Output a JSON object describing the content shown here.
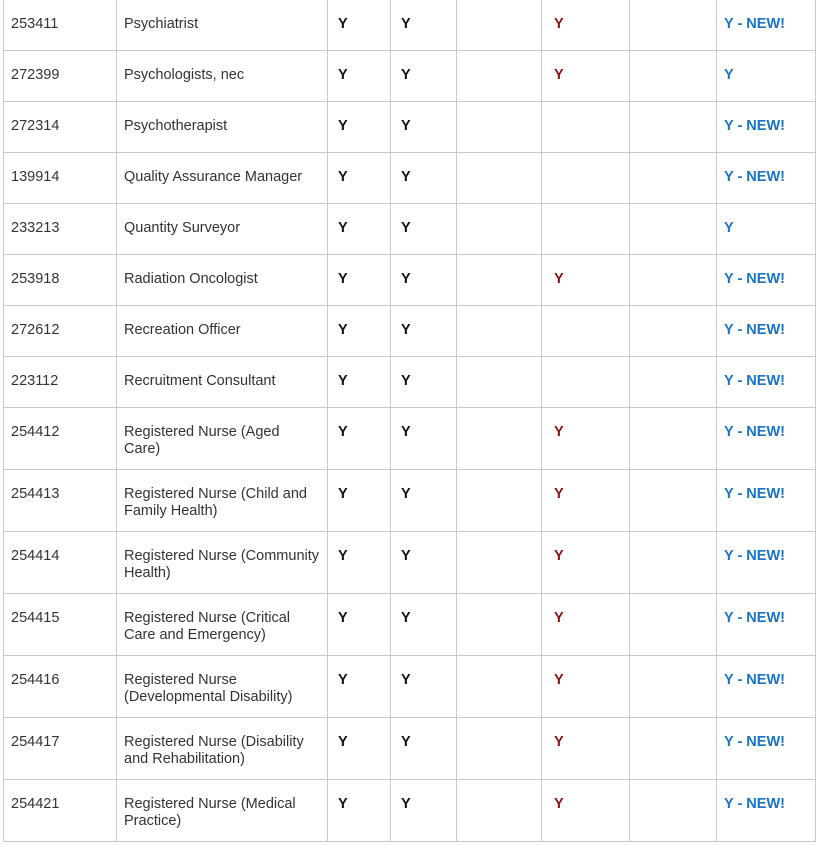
{
  "rows": [
    {
      "code": "253411",
      "occupation": "Psychiatrist",
      "col3": "Y",
      "col4": "Y",
      "col5": "",
      "col6": "Y",
      "col7": "",
      "col8": "Y - NEW!"
    },
    {
      "code": "272399",
      "occupation": "Psychologists, nec",
      "col3": "Y",
      "col4": "Y",
      "col5": "",
      "col6": "Y",
      "col7": "",
      "col8": "Y"
    },
    {
      "code": "272314",
      "occupation": "Psychotherapist",
      "col3": "Y",
      "col4": "Y",
      "col5": "",
      "col6": "",
      "col7": "",
      "col8": "Y - NEW!"
    },
    {
      "code": "139914",
      "occupation": "Quality Assurance Manager",
      "col3": "Y",
      "col4": "Y",
      "col5": "",
      "col6": "",
      "col7": "",
      "col8": "Y - NEW!"
    },
    {
      "code": "233213",
      "occupation": "Quantity Surveyor",
      "col3": "Y",
      "col4": "Y",
      "col5": "",
      "col6": "",
      "col7": "",
      "col8": "Y"
    },
    {
      "code": "253918",
      "occupation": "Radiation Oncologist",
      "col3": "Y",
      "col4": "Y",
      "col5": "",
      "col6": "Y",
      "col7": "",
      "col8": "Y - NEW!"
    },
    {
      "code": "272612",
      "occupation": "Recreation Officer",
      "col3": "Y",
      "col4": "Y",
      "col5": "",
      "col6": "",
      "col7": "",
      "col8": "Y - NEW!"
    },
    {
      "code": "223112",
      "occupation": "Recruitment Consultant",
      "col3": "Y",
      "col4": "Y",
      "col5": "",
      "col6": "",
      "col7": "",
      "col8": "Y - NEW!"
    },
    {
      "code": "254412",
      "occupation": "Registered Nurse (Aged Care)",
      "col3": "Y",
      "col4": "Y",
      "col5": "",
      "col6": "Y",
      "col7": "",
      "col8": "Y - NEW!"
    },
    {
      "code": "254413",
      "occupation": "Registered Nurse (Child and Family Health)",
      "col3": "Y",
      "col4": "Y",
      "col5": "",
      "col6": "Y",
      "col7": "",
      "col8": "Y - NEW!"
    },
    {
      "code": "254414",
      "occupation": "Registered Nurse (Community Health)",
      "col3": "Y",
      "col4": "Y",
      "col5": "",
      "col6": "Y",
      "col7": "",
      "col8": "Y - NEW!"
    },
    {
      "code": "254415",
      "occupation": "Registered Nurse (Critical Care and Emergency)",
      "col3": "Y",
      "col4": "Y",
      "col5": "",
      "col6": "Y",
      "col7": "",
      "col8": "Y - NEW!"
    },
    {
      "code": "254416",
      "occupation": "Registered Nurse (Developmental Disability)",
      "col3": "Y",
      "col4": "Y",
      "col5": "",
      "col6": "Y",
      "col7": "",
      "col8": "Y - NEW!"
    },
    {
      "code": "254417",
      "occupation": "Registered Nurse (Disability and Rehabilitation)",
      "col3": "Y",
      "col4": "Y",
      "col5": "",
      "col6": "Y",
      "col7": "",
      "col8": "Y - NEW!"
    },
    {
      "code": "254421",
      "occupation": "Registered Nurse (Medical Practice)",
      "col3": "Y",
      "col4": "Y",
      "col5": "",
      "col6": "Y",
      "col7": "",
      "col8": "Y - NEW!"
    }
  ]
}
